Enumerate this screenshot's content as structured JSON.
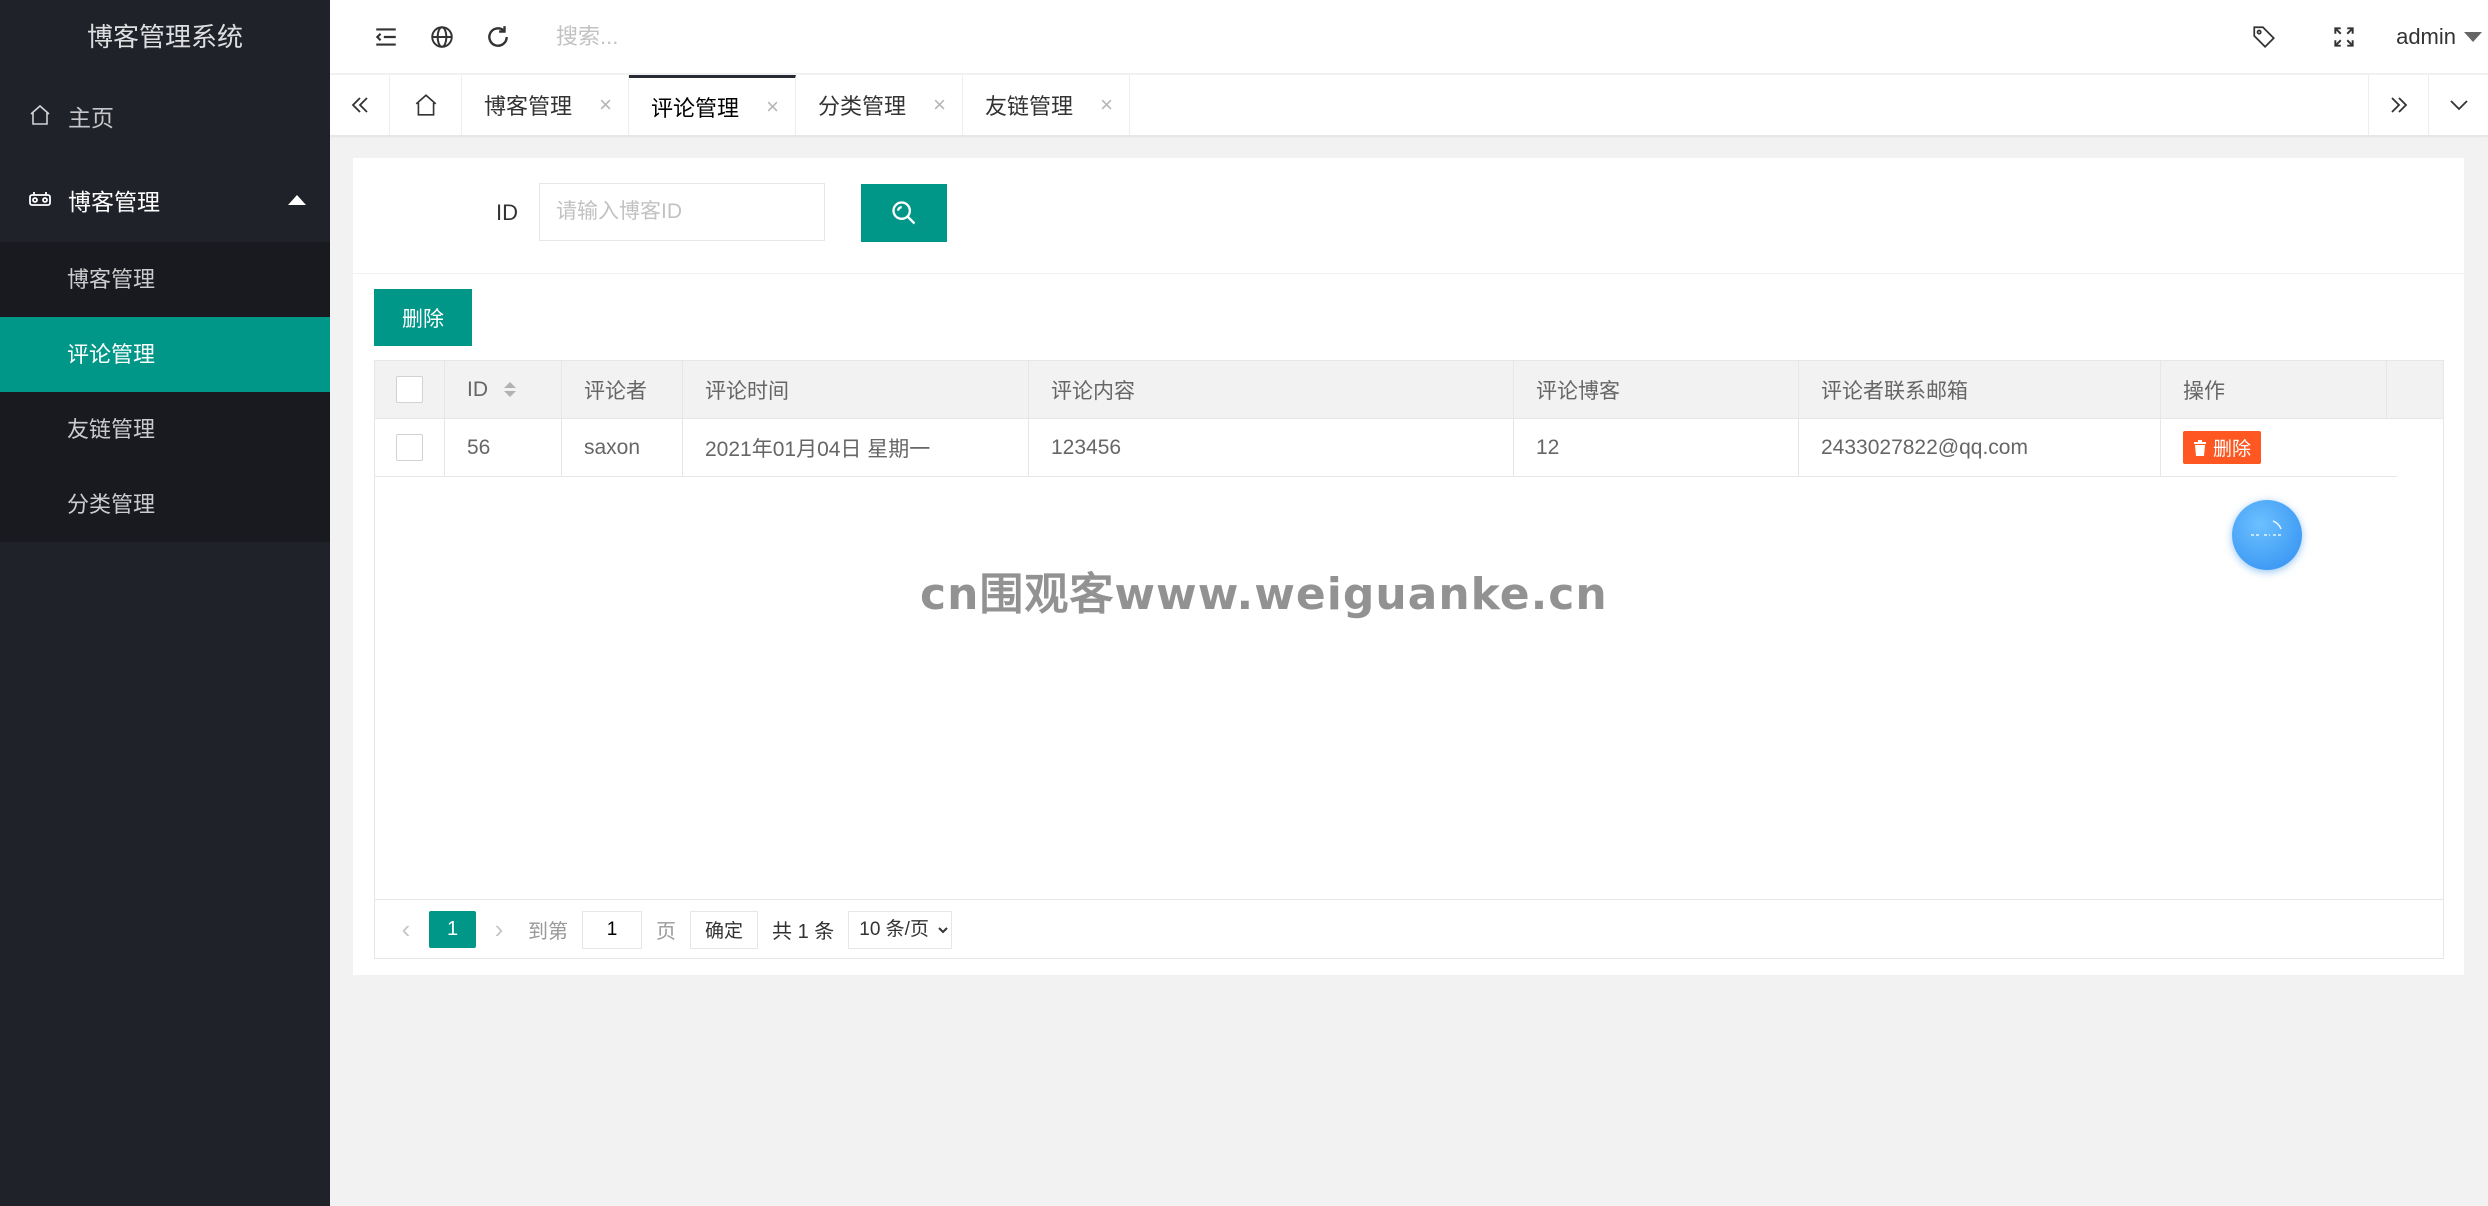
{
  "app": {
    "title": "博客管理系统"
  },
  "sidebar": {
    "home": "主页",
    "group": "博客管理",
    "items": [
      {
        "label": "博客管理",
        "active": false
      },
      {
        "label": "评论管理",
        "active": true
      },
      {
        "label": "友链管理",
        "active": false
      },
      {
        "label": "分类管理",
        "active": false
      }
    ]
  },
  "header": {
    "search_placeholder": "搜索...",
    "user": "admin"
  },
  "tabs": [
    {
      "label": "博客管理",
      "close": "×"
    },
    {
      "label": "评论管理",
      "close": "×",
      "active": true
    },
    {
      "label": "分类管理",
      "close": "×"
    },
    {
      "label": "友链管理",
      "close": "×"
    }
  ],
  "filter": {
    "id_label": "ID",
    "id_placeholder": "请输入博客ID"
  },
  "toolbar": {
    "delete_label": "删除"
  },
  "table": {
    "columns": [
      "ID",
      "评论者",
      "评论时间",
      "评论内容",
      "评论博客",
      "评论者联系邮箱",
      "操作"
    ],
    "rows": [
      {
        "id": "56",
        "commenter": "saxon",
        "time": "2021年01月04日 星期一",
        "content": "123456",
        "blog": "12",
        "email": "2433027822@qq.com",
        "action": "删除"
      }
    ]
  },
  "pager": {
    "current": "1",
    "goto_label": "到第",
    "goto_value": "1",
    "page_label": "页",
    "confirm": "确定",
    "total": "共 1 条",
    "page_size": "10 条/页"
  },
  "watermark": "cn围观客www.weiguanke.cn",
  "colors": {
    "accent": "#009688",
    "danger": "#ff5722",
    "sidebar_bg": "#20222a"
  }
}
